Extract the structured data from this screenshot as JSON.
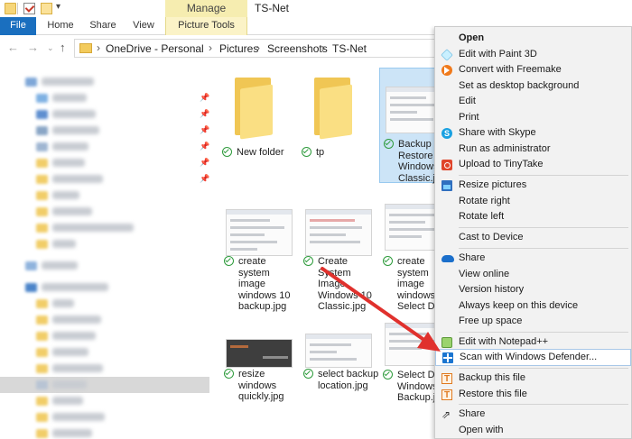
{
  "quick_access": {
    "dropdown_glyph": "▾"
  },
  "window": {
    "title": "TS-Net",
    "contextual_group": "Manage"
  },
  "ribbon": {
    "tabs": [
      "File",
      "Home",
      "Share",
      "View",
      "Picture Tools"
    ]
  },
  "nav": {
    "back": "←",
    "forward": "→",
    "recent": "⌄",
    "up": "↑"
  },
  "address": {
    "crumbs": [
      "OneDrive - Personal",
      "Pictures",
      "Screenshots",
      "TS-Net"
    ],
    "separator": "›"
  },
  "files": [
    {
      "name_lines": [
        "New folder"
      ],
      "type": "folder",
      "selected": false,
      "synced": true
    },
    {
      "name_lines": [
        "tp"
      ],
      "type": "folder",
      "selected": false,
      "synced": true
    },
    {
      "name_lines": [
        "Backup",
        "Restore",
        "Windows",
        "Classic.jpg"
      ],
      "type": "image",
      "selected": true,
      "synced": true
    },
    {
      "name_lines": [
        "create system",
        "image",
        "windows 10",
        "backup.jpg"
      ],
      "type": "image",
      "selected": false,
      "synced": true
    },
    {
      "name_lines": [
        "Create System",
        "Image",
        "Windows 10",
        "Classic.jpg"
      ],
      "type": "image",
      "selected": false,
      "synced": true
    },
    {
      "name_lines": [
        "create system",
        "image",
        "windows 10",
        "Select Drive"
      ],
      "type": "image",
      "selected": false,
      "synced": true
    },
    {
      "name_lines": [
        "resize windows",
        "quickly.jpg"
      ],
      "type": "image",
      "selected": false,
      "synced": true
    },
    {
      "name_lines": [
        "select backup",
        "location.jpg"
      ],
      "type": "image",
      "selected": false,
      "synced": true
    },
    {
      "name_lines": [
        "Select Drive",
        "Windows",
        "Backup.jpg"
      ],
      "type": "image",
      "selected": false,
      "synced": true
    }
  ],
  "context_menu": {
    "groups": [
      [
        {
          "label": "Open",
          "bold": true,
          "icon": ""
        },
        {
          "label": "Edit with Paint 3D",
          "icon": "paint3d-icon"
        },
        {
          "label": "Convert with Freemake",
          "icon": "freemake-icon"
        },
        {
          "label": "Set as desktop background",
          "icon": ""
        },
        {
          "label": "Edit",
          "icon": ""
        },
        {
          "label": "Print",
          "icon": ""
        },
        {
          "label": "Share with Skype",
          "icon": "skype-icon"
        },
        {
          "label": "Run as administrator",
          "icon": ""
        },
        {
          "label": "Upload to TinyTake",
          "icon": "tinytake-icon"
        }
      ],
      [
        {
          "label": "Resize pictures",
          "icon": "resize-icon"
        },
        {
          "label": "Rotate right",
          "icon": ""
        },
        {
          "label": "Rotate left",
          "icon": ""
        }
      ],
      [
        {
          "label": "Cast to Device",
          "icon": ""
        }
      ],
      [
        {
          "label": "Share",
          "icon": "onedrive-icon"
        },
        {
          "label": "View online",
          "icon": ""
        },
        {
          "label": "Version history",
          "icon": ""
        },
        {
          "label": "Always keep on this device",
          "icon": ""
        },
        {
          "label": "Free up space",
          "icon": ""
        }
      ],
      [
        {
          "label": "Edit with Notepad++",
          "icon": "notepadpp-icon"
        },
        {
          "label": "Scan with Windows Defender...",
          "icon": "defender-icon",
          "hover": true
        }
      ],
      [
        {
          "label": "Backup this file",
          "icon": "backup-icon"
        },
        {
          "label": "Restore this file",
          "icon": "restore-icon"
        }
      ],
      [
        {
          "label": "Share",
          "icon": "share-icon"
        },
        {
          "label": "Open with",
          "icon": ""
        }
      ]
    ]
  },
  "colors": {
    "accent": "#1a6fbf",
    "manage_band": "#f6edb0",
    "arrow": "#e0312d",
    "selection": "#cce4f7",
    "sync_green": "#2e9b3c"
  }
}
